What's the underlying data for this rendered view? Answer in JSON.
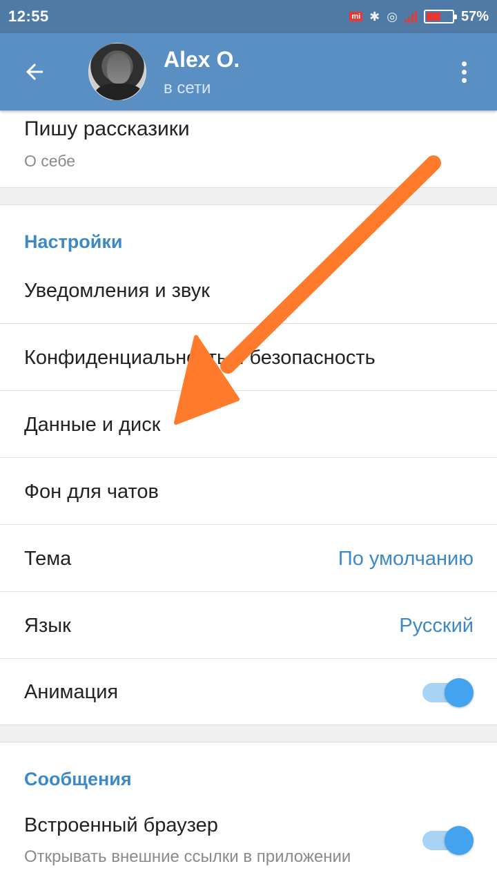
{
  "status_bar": {
    "time": "12:55",
    "battery_percent_text": "57%",
    "battery_level": 0.57,
    "icons": [
      "mi-icon",
      "bluetooth-icon",
      "location-icon",
      "signal-icon",
      "battery-icon"
    ]
  },
  "app_bar": {
    "user_name": "Alex O.",
    "user_status": "в сети",
    "background_color": "#5a8fc4"
  },
  "profile": {
    "bio": "Пишу рассказики",
    "bio_label": "О себе"
  },
  "settings": {
    "title": "Настройки",
    "items": [
      {
        "label": "Уведомления и звук"
      },
      {
        "label": "Конфиденциальность и безопасность"
      },
      {
        "label": "Данные и диск"
      },
      {
        "label": "Фон для чатов"
      },
      {
        "label": "Тема",
        "value": "По умолчанию"
      },
      {
        "label": "Язык",
        "value": "Русский"
      },
      {
        "label": "Анимация",
        "toggle": true
      }
    ]
  },
  "messages": {
    "title": "Сообщения",
    "browser_label": "Встроенный браузер",
    "browser_sub": "Открывать внешние ссылки в приложении",
    "browser_toggle": true
  },
  "colors": {
    "accent": "#3d88c7",
    "toggle_thumb": "#43a3ee",
    "arrow": "#ff7a2b"
  }
}
